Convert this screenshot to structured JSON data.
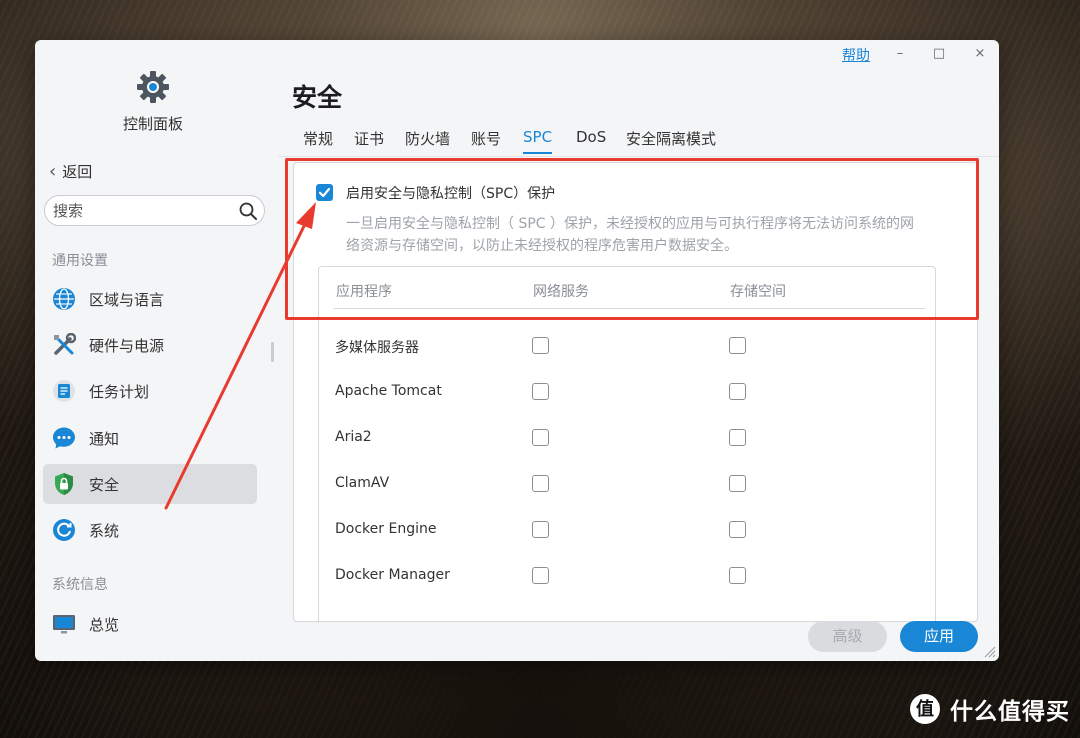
{
  "window": {
    "help": "帮助",
    "minimize_glyph": "–",
    "maximize_glyph": "□",
    "close_glyph": "×"
  },
  "sidebar": {
    "app_title": "控制面板",
    "back_label": "返回",
    "search_placeholder": "搜索",
    "section_general": "通用设置",
    "items": [
      {
        "label": "区域与语言",
        "icon": "globe-icon"
      },
      {
        "label": "硬件与电源",
        "icon": "tools-icon"
      },
      {
        "label": "任务计划",
        "icon": "task-schedule-icon"
      },
      {
        "label": "通知",
        "icon": "chat-bubble-icon"
      },
      {
        "label": "安全",
        "icon": "shield-lock-icon",
        "active": true
      },
      {
        "label": "系统",
        "icon": "system-refresh-icon"
      }
    ],
    "section_info": "系统信息",
    "info_items": [
      {
        "label": "总览",
        "icon": "monitor-icon"
      }
    ]
  },
  "main": {
    "title": "安全",
    "tabs": [
      "常规",
      "证书",
      "防火墙",
      "账号",
      "SPC",
      "DoS",
      "安全隔离模式"
    ],
    "active_tab": "SPC",
    "spc_label": "启用安全与隐私控制（SPC）保护",
    "spc_checked": true,
    "spc_desc_line1": "一旦启用安全与隐私控制（ SPC ）保护，未经授权的应用与可执行程序将无法访问系统的网",
    "spc_desc_line2": "络资源与存储空间，以防止未经授权的程序危害用户数据安全。",
    "table": {
      "headers": [
        "应用程序",
        "网络服务",
        "存储空间"
      ],
      "rows": [
        {
          "name": "多媒体服务器",
          "network": false,
          "storage": false
        },
        {
          "name": "Apache Tomcat",
          "network": false,
          "storage": false
        },
        {
          "name": "Aria2",
          "network": false,
          "storage": false
        },
        {
          "name": "ClamAV",
          "network": false,
          "storage": false
        },
        {
          "name": "Docker Engine",
          "network": false,
          "storage": false
        },
        {
          "name": "Docker Manager",
          "network": false,
          "storage": false
        }
      ]
    },
    "advanced_label": "高级",
    "apply_label": "应用"
  },
  "colors": {
    "accent": "#1a86d6",
    "annotation_red": "#e83a2f"
  },
  "watermark": {
    "text": "什么值得买",
    "logo": "smzdm-logo"
  }
}
